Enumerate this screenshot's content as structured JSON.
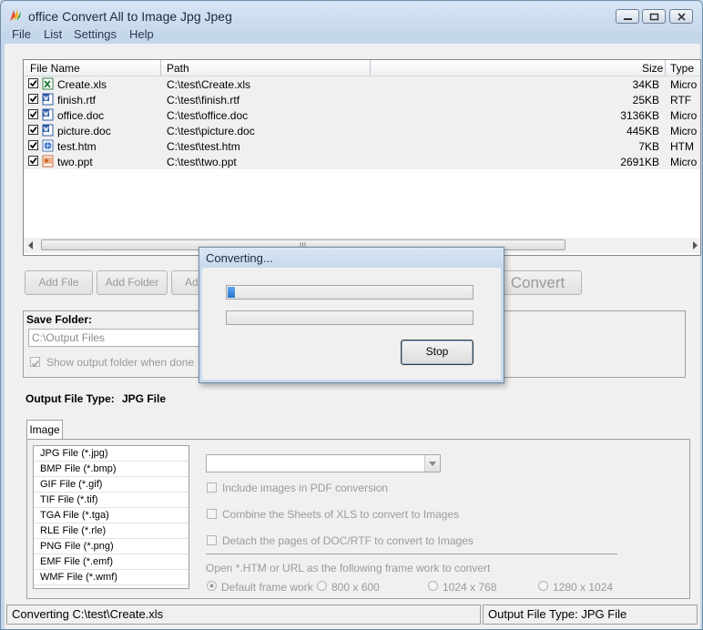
{
  "window": {
    "title": "office Convert All to Image Jpg Jpeg",
    "buttons": [
      "minimize",
      "maximize",
      "close"
    ]
  },
  "menu": [
    "File",
    "List",
    "Settings",
    "Help"
  ],
  "file_list": {
    "columns": [
      "File Name",
      "Path",
      "Size",
      "Type"
    ],
    "rows": [
      {
        "name": "Create.xls",
        "path": "C:\\test\\Create.xls",
        "size": "34KB",
        "type": "Micro",
        "icon": "excel-file-icon",
        "checked": true
      },
      {
        "name": "finish.rtf",
        "path": "C:\\test\\finish.rtf",
        "size": "25KB",
        "type": "RTF",
        "icon": "word-file-icon",
        "checked": true
      },
      {
        "name": "office.doc",
        "path": "C:\\test\\office.doc",
        "size": "3136KB",
        "type": "Micro",
        "icon": "word-file-icon",
        "checked": true
      },
      {
        "name": "picture.doc",
        "path": "C:\\test\\picture.doc",
        "size": "445KB",
        "type": "Micro",
        "icon": "word-file-icon",
        "checked": true
      },
      {
        "name": "test.htm",
        "path": "C:\\test\\test.htm",
        "size": "7KB",
        "type": "HTM",
        "icon": "html-file-icon",
        "checked": true
      },
      {
        "name": "two.ppt",
        "path": "C:\\test\\two.ppt",
        "size": "2691KB",
        "type": "Micro",
        "icon": "powerpoint-file-icon",
        "checked": true
      }
    ]
  },
  "toolbar": {
    "add_file": "Add File",
    "add_folder": "Add Folder",
    "add_partial": "Ad",
    "convert": "Convert"
  },
  "save_folder": {
    "label": "Save Folder:",
    "value": "C:\\Output Files",
    "show_when_done": "Show output folder when done",
    "show_when_done_checked": true
  },
  "output_type": {
    "label": "Output File Type:",
    "value": "JPG File"
  },
  "tabs": [
    "Image"
  ],
  "image_types": [
    "JPG File  (*.jpg)",
    "BMP File  (*.bmp)",
    "GIF File  (*.gif)",
    "TIF File  (*.tif)",
    "TGA File  (*.tga)",
    "RLE File  (*.rle)",
    "PNG File  (*.png)",
    "EMF File  (*.emf)",
    "WMF File  (*.wmf)"
  ],
  "options": {
    "include_pdf": "Include images in PDF conversion",
    "combine_xls": "Combine the Sheets of XLS to convert to Images",
    "detach_doc": "Detach the pages of DOC/RTF to convert to Images",
    "htm_label": "Open *.HTM or URL as the following frame work to convert",
    "frames": [
      "Default frame work",
      "800 x 600",
      "1024 x 768",
      "1280 x 1024"
    ],
    "frame_selected": "Default frame work"
  },
  "status": {
    "left": "Converting  C:\\test\\Create.xls",
    "right": "Output File Type:  JPG File"
  },
  "dialog": {
    "title": "Converting...",
    "progress1": 0.03,
    "progress2": 0.0,
    "stop": "Stop"
  },
  "colors": {
    "progress": "#2f80d8",
    "title_bg": "#cfdeef",
    "excel": "#1f7a3a",
    "word": "#2b57a6",
    "ppt": "#d1642b"
  }
}
